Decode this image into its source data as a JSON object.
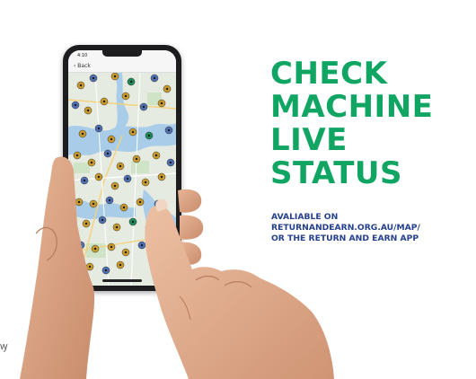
{
  "headline": {
    "lines": [
      "CHECK",
      "MACHINE",
      "LIVE",
      "STATUS"
    ]
  },
  "subtext": {
    "lines": [
      "AVALIABLE ON",
      "RETURNANDEARN.ORG.AU/MAP/",
      "OR THE RETURN AND EARN APP"
    ]
  },
  "phone": {
    "status_time": "4:10",
    "back_label": "‹ Back"
  },
  "left_edge_mark": "ꝡ",
  "colors": {
    "headline_green": "#10a562",
    "subtext_blue": "#25408f",
    "pin_gold": "#c89a2b",
    "pin_blue": "#4f6fb0",
    "pin_green": "#1f8a5a",
    "map_water": "#9ec6e6",
    "map_land": "#e8ece4"
  },
  "icons": [
    "map-pin-icon",
    "back-chevron-icon"
  ]
}
